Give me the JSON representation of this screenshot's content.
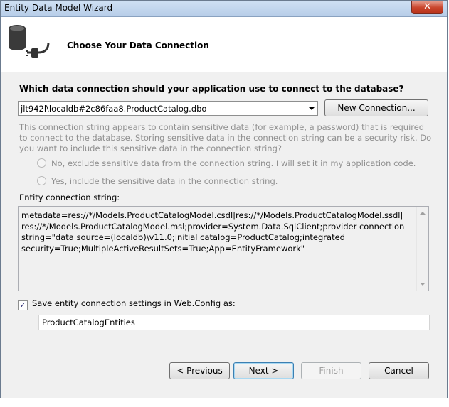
{
  "window": {
    "title": "Entity Data Model Wizard",
    "close_glyph": "✕"
  },
  "header": {
    "title": "Choose Your Data Connection",
    "icon": "database-plug-icon"
  },
  "main": {
    "question": "Which data connection should your application use to connect to the database?",
    "connection_combo": {
      "value": "jlt942l\\localdb#2c86faa8.ProductCatalog.dbo"
    },
    "new_connection_label": "New Connection...",
    "sensitive_info": "This connection string appears to contain sensitive data (for example, a password) that is required to connect to the database. Storing sensitive data in the connection string can be a security risk. Do you want to include this sensitive data in the connection string?",
    "radio_exclude": "No, exclude sensitive data from the connection string. I will set it in my application code.",
    "radio_include": "Yes, include the sensitive data in the connection string.",
    "entity_label": "Entity connection string:",
    "entity_connection_string": "metadata=res://*/Models.ProductCatalogModel.csdl|res://*/Models.ProductCatalogModel.ssdl|\nres://*/Models.ProductCatalogModel.msl;provider=System.Data.SqlClient;provider connection\nstring=\"data source=(localdb)\\v11.0;initial catalog=ProductCatalog;integrated\nsecurity=True;MultipleActiveResultSets=True;App=EntityFramework\"",
    "save_checkbox_label": "Save entity connection settings in Web.Config as:",
    "save_checked": true,
    "entities_name": "ProductCatalogEntities"
  },
  "footer": {
    "previous_label": "< Previous",
    "next_label": "Next >",
    "finish_label": "Finish",
    "cancel_label": "Cancel"
  }
}
